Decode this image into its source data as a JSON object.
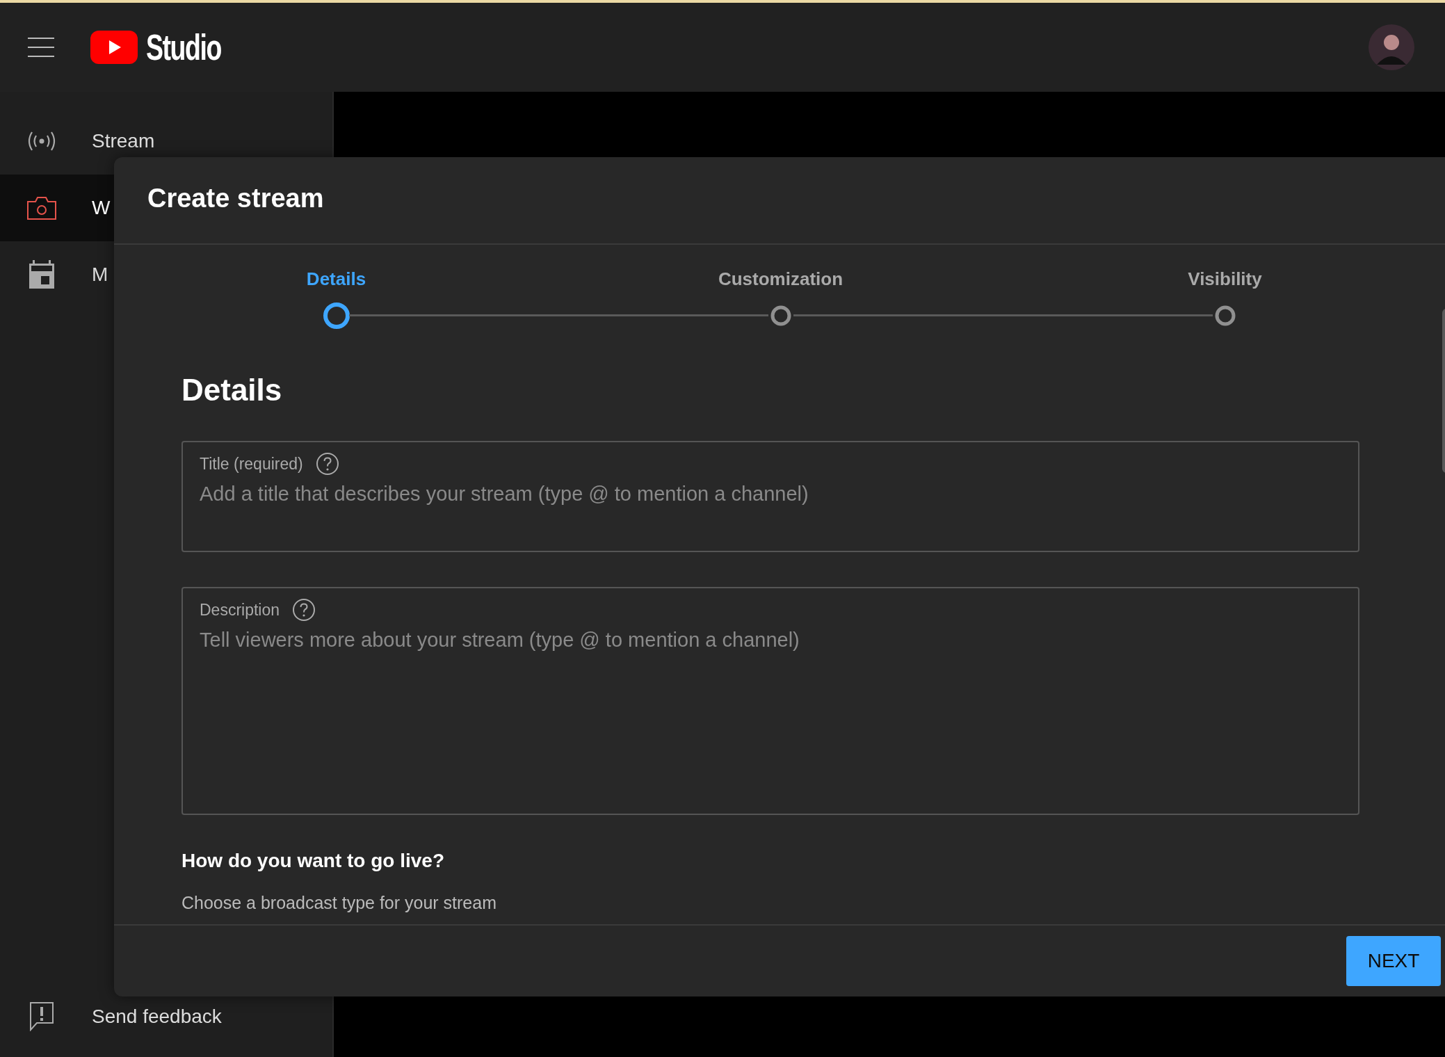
{
  "header": {
    "logo_text": "Studio"
  },
  "sidebar": {
    "items": [
      {
        "kind": "stream",
        "label": "Stream",
        "selected": false
      },
      {
        "kind": "webcam",
        "label": "W",
        "selected": true
      },
      {
        "kind": "manage",
        "label": "M",
        "selected": false
      }
    ],
    "footer_item": {
      "label": "Send feedback"
    }
  },
  "dialog": {
    "title": "Create stream",
    "steps": [
      {
        "label": "Details",
        "selected": true
      },
      {
        "label": "Customization",
        "selected": false
      },
      {
        "label": "Visibility",
        "selected": false
      }
    ],
    "section_title": "Details",
    "fields": [
      {
        "kind": "single",
        "label": "Title (required)",
        "placeholder": "Add a title that describes your stream (type @ to mention a channel)"
      },
      {
        "kind": "multi",
        "label": "Description",
        "placeholder": "Tell viewers more about your stream (type @ to mention a channel)"
      }
    ],
    "question": "How do you want to go live?",
    "hint": "Choose a broadcast type for your stream",
    "next_button": "NEXT"
  }
}
